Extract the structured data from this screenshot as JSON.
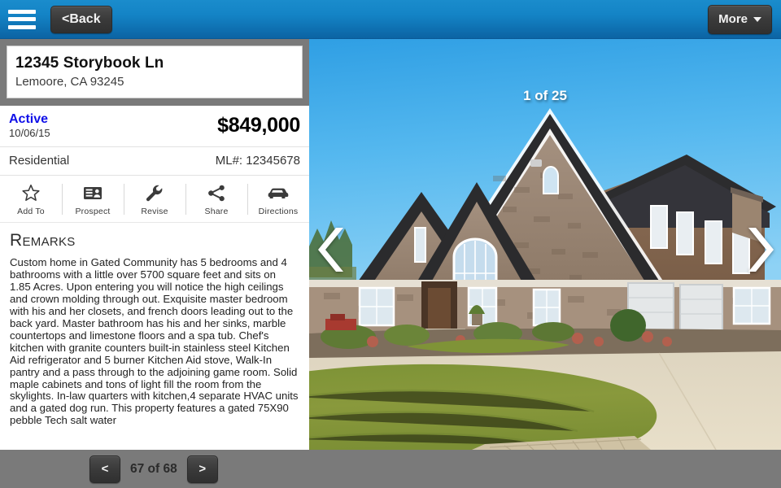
{
  "topbar": {
    "menu_icon": "hamburger-menu-icon",
    "back_label": "<Back",
    "more_label": "More",
    "more_caret_icon": "chevron-down-icon"
  },
  "listing": {
    "address_line1": "12345 Storybook Ln",
    "address_line2": "Lemoore, CA 93245",
    "status": "Active",
    "status_color": "#1010e8",
    "status_date": "10/06/15",
    "price": "$849,000",
    "property_type": "Residential",
    "mls": "ML#: 12345678"
  },
  "actions": [
    {
      "label": "Add To",
      "icon": "star-outline-icon"
    },
    {
      "label": "Prospect",
      "icon": "contact-card-icon"
    },
    {
      "label": "Revise",
      "icon": "wrench-icon"
    },
    {
      "label": "Share",
      "icon": "share-nodes-icon"
    },
    {
      "label": "Directions",
      "icon": "car-icon"
    }
  ],
  "remarks": {
    "heading": "Remarks",
    "body": "Custom home in Gated Community has 5 bedrooms and 4 bathrooms with a little over 5700 square feet and sits on 1.85 Acres. Upon entering you will notice the high ceilings and crown molding through out. Exquisite master bedroom with his and her closets, and french doors leading out to the back yard. Master bathroom has his and her sinks, marble countertops and limestone floors and a spa tub. Chef's kitchen with granite counters built-in stainless steel Kitchen Aid refrigerator and 5 burner Kitchen Aid stove, Walk-In pantry and a pass through to the adjoining game room. Solid maple cabinets and tons of light fill the room from the skylights. In-law quarters with kitchen,4 separate HVAC units and a gated dog run. This property features a gated 75X90 pebble Tech salt water"
  },
  "photo": {
    "counter": "1 of 25",
    "prev_icon": "chevron-left-icon",
    "next_icon": "chevron-right-icon",
    "alt": "two-story brick and stone house with dark gabled roof, green lawn and concrete driveway under blue sky"
  },
  "footer": {
    "prev_label": "<",
    "page_label": "67 of 68",
    "next_label": ">"
  }
}
